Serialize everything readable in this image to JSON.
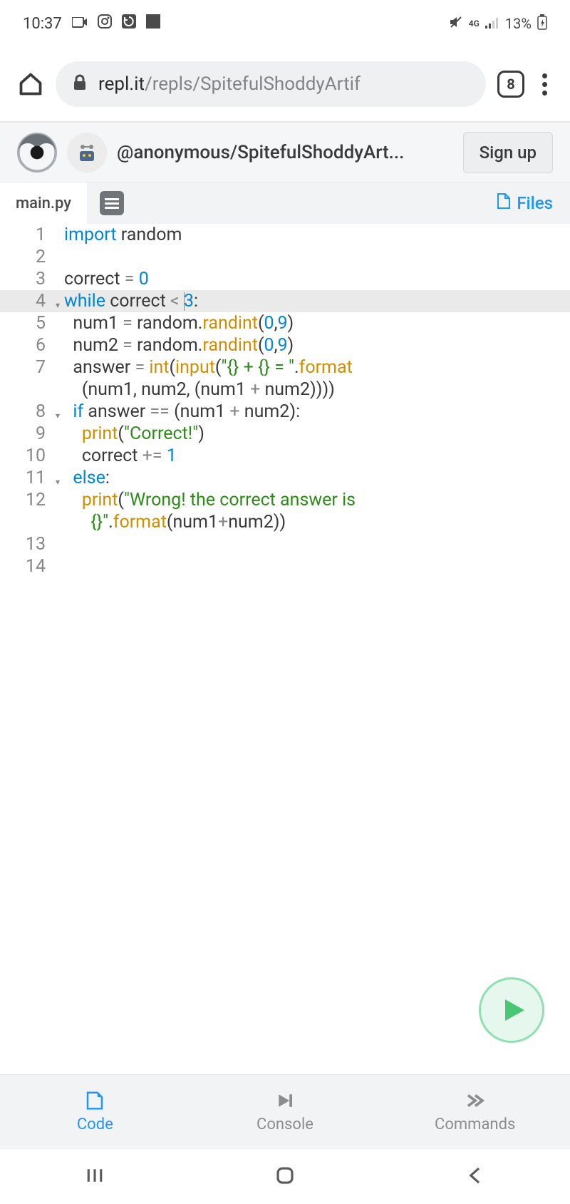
{
  "status": {
    "time": "10:37",
    "battery": "13%",
    "network": "4G"
  },
  "browser": {
    "url_domain": "repl.it",
    "url_path": "/repls/SpitefulShoddyArtif",
    "tab_count": "8"
  },
  "replit": {
    "repl_title": "@anonymous/SpitefulShoddyArt...",
    "signup": "Sign up",
    "file_name": "main.py",
    "files_label": "Files"
  },
  "code_lines": [
    {
      "n": "1",
      "html": "<span class='kw'>import</span> <span class='var'>random</span>"
    },
    {
      "n": "2",
      "html": ""
    },
    {
      "n": "3",
      "html": "<span class='var'>correct</span> <span class='op'>=</span> <span class='num'>0</span>"
    },
    {
      "n": "4",
      "fold": true,
      "highlight": true,
      "html": "<span class='kw'>while</span> <span class='var'>correct</span> <span class='op'>&lt;</span> <span class='cursor-mark'></span><span class='num'>3</span><span class='par'>:</span>"
    },
    {
      "n": "5",
      "html": "  <span class='var'>num1</span> <span class='op'>=</span> <span class='var'>random</span><span class='par'>.</span><span class='fn'>randint</span><span class='par'>(</span><span class='num'>0</span><span class='par'>,</span><span class='num'>9</span><span class='par'>)</span>"
    },
    {
      "n": "6",
      "html": "  <span class='var'>num2</span> <span class='op'>=</span> <span class='var'>random</span><span class='par'>.</span><span class='fn'>randint</span><span class='par'>(</span><span class='num'>0</span><span class='par'>,</span><span class='num'>9</span><span class='par'>)</span>"
    },
    {
      "n": "7",
      "html": "  <span class='var'>answer</span> <span class='op'>=</span> <span class='fn'>int</span><span class='par'>(</span><span class='fn'>input</span><span class='par'>(</span><span class='str'>\"{} + {} = \"</span><span class='par'>.</span><span class='fn'>format</span>"
    },
    {
      "n": "",
      "html": "    <span class='par'>(</span><span class='var'>num1</span><span class='par'>,</span> <span class='var'>num2</span><span class='par'>,</span> <span class='par'>(</span><span class='var'>num1</span> <span class='op'>+</span> <span class='var'>num2</span><span class='par'>))))</span>"
    },
    {
      "n": "8",
      "fold": true,
      "html": "  <span class='kw'>if</span> <span class='var'>answer</span> <span class='op'>==</span> <span class='par'>(</span><span class='var'>num1</span> <span class='op'>+</span> <span class='var'>num2</span><span class='par'>):</span>"
    },
    {
      "n": "9",
      "html": "    <span class='fn'>print</span><span class='par'>(</span><span class='str'>\"Correct!\"</span><span class='par'>)</span>"
    },
    {
      "n": "10",
      "html": "    <span class='var'>correct</span> <span class='op'>+=</span> <span class='num'>1</span>"
    },
    {
      "n": "11",
      "fold": true,
      "html": "  <span class='kw'>else</span><span class='par'>:</span>"
    },
    {
      "n": "12",
      "html": "    <span class='fn'>print</span><span class='par'>(</span><span class='str'>\"Wrong! the correct answer is </span>"
    },
    {
      "n": "",
      "html": "      <span class='str'>{}\"</span><span class='par'>.</span><span class='fn'>format</span><span class='par'>(</span><span class='var'>num1</span><span class='op'>+</span><span class='var'>num2</span><span class='par'>))</span>"
    },
    {
      "n": "13",
      "html": ""
    },
    {
      "n": "14",
      "html": ""
    }
  ],
  "bottom_tabs": {
    "code": "Code",
    "console": "Console",
    "commands": "Commands"
  }
}
